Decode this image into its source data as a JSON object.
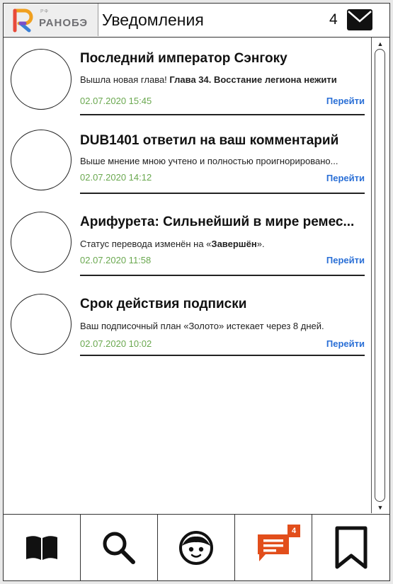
{
  "header": {
    "logo_small": "РФ",
    "logo_text": "РАНОБЭ",
    "title": "Уведомления",
    "count": "4",
    "mail_icon": "envelope-icon"
  },
  "notifications": [
    {
      "title": "Последний император Сэнгоку",
      "text_prefix": "Вышла новая глава! ",
      "text_bold": "Глава 34. Восстание легиона нежити",
      "text_suffix": "",
      "date": "02.07.2020 15:45",
      "link": "Перейти"
    },
    {
      "title": "DUB1401 ответил на ваш комментарий",
      "text_prefix": "Выше мнение мною учтено и полностью проигнорировано...",
      "text_bold": "",
      "text_suffix": "",
      "date": "02.07.2020 14:12",
      "link": "Перейти"
    },
    {
      "title": "Арифурета: Сильнейший в мире ремес...",
      "text_prefix": "Статус перевода изменён на «",
      "text_bold": "Завершён",
      "text_suffix": "».",
      "date": "02.07.2020 11:58",
      "link": "Перейти"
    },
    {
      "title": "Срок действия подписки",
      "text_prefix": "Ваш подписочный план «Золото» истекает через 8 дней.",
      "text_bold": "",
      "text_suffix": "",
      "date": "02.07.2020 10:02",
      "link": "Перейти"
    }
  ],
  "bottom_nav": {
    "tabs": [
      "book-icon",
      "search-icon",
      "profile-face-icon",
      "messages-icon",
      "bookmark-icon"
    ],
    "messages_badge": "4"
  },
  "colors": {
    "date_green": "#6aa84f",
    "link_blue": "#2a6fd6",
    "accent_orange": "#e24e1b"
  }
}
